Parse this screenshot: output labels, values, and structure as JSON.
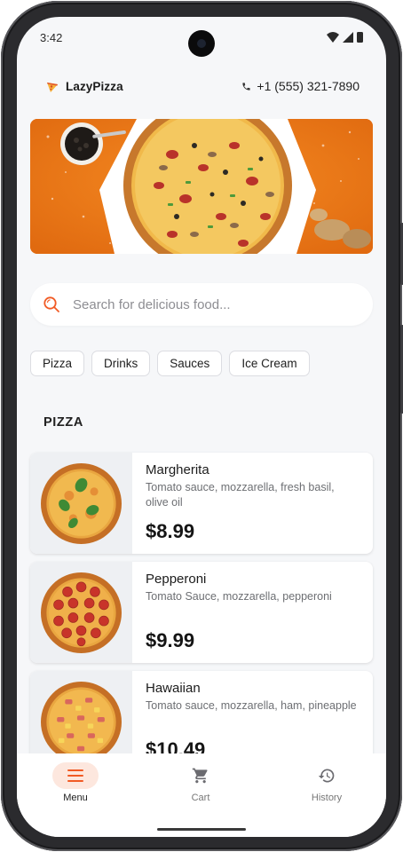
{
  "status_bar": {
    "time": "3:42"
  },
  "header": {
    "brand": "LazyPizza",
    "phone": "+1 (555) 321-7890"
  },
  "search": {
    "placeholder": "Search for delicious food..."
  },
  "categories": [
    "Pizza",
    "Drinks",
    "Sauces",
    "Ice Cream"
  ],
  "section": {
    "title": "PIZZA"
  },
  "products": [
    {
      "name": "Margherita",
      "description": "Tomato sauce, mozzarella, fresh basil, olive oil",
      "price": "$8.99"
    },
    {
      "name": "Pepperoni",
      "description": "Tomato Sauce, mozzarella, pepperoni",
      "price": "$9.99"
    },
    {
      "name": "Hawaiian",
      "description": "Tomato sauce, mozzarella, ham, pineapple",
      "price": "$10.49"
    }
  ],
  "bottom_nav": [
    {
      "label": "Menu",
      "icon": "menu-icon",
      "active": true
    },
    {
      "label": "Cart",
      "icon": "cart-icon",
      "active": false
    },
    {
      "label": "History",
      "icon": "history-icon",
      "active": false
    }
  ],
  "colors": {
    "accent": "#f15a24",
    "banner": "#ee7a1a",
    "background": "#f6f7f9",
    "active_nav": "#fde7de"
  }
}
